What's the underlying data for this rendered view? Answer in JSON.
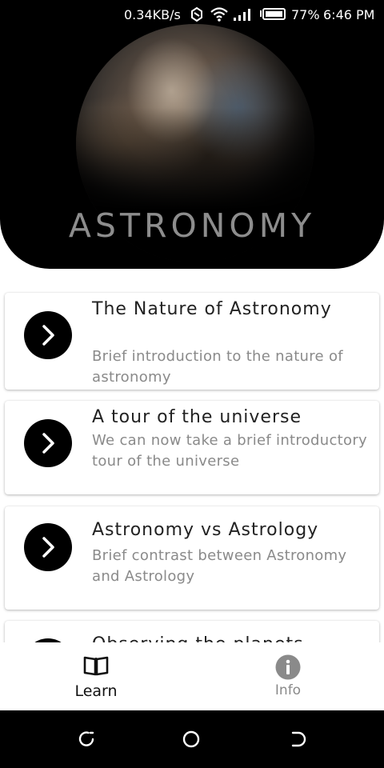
{
  "status_bar": {
    "net_speed": "0.34KB/s",
    "battery": "77%",
    "time": "6:46 PM"
  },
  "header": {
    "title": "ASTRONOMY"
  },
  "lessons": [
    {
      "title": "The Nature of Astronomy",
      "description": "Brief introduction to the nature of astronomy"
    },
    {
      "title": "A tour of the universe",
      "description": "We can now take a brief introductory tour of the universe"
    },
    {
      "title": "Astronomy vs Astrology",
      "description": "Brief contrast between Astronomy and Astrology"
    },
    {
      "title": "Observing the planets",
      "description": ""
    }
  ],
  "bottom_nav": {
    "learn_label": "Learn",
    "info_label": "Info"
  },
  "colors": {
    "header_bg": "#000000",
    "title_color": "#8d8d8d",
    "active_nav": "#111111",
    "inactive_nav": "#8a8a8a"
  }
}
